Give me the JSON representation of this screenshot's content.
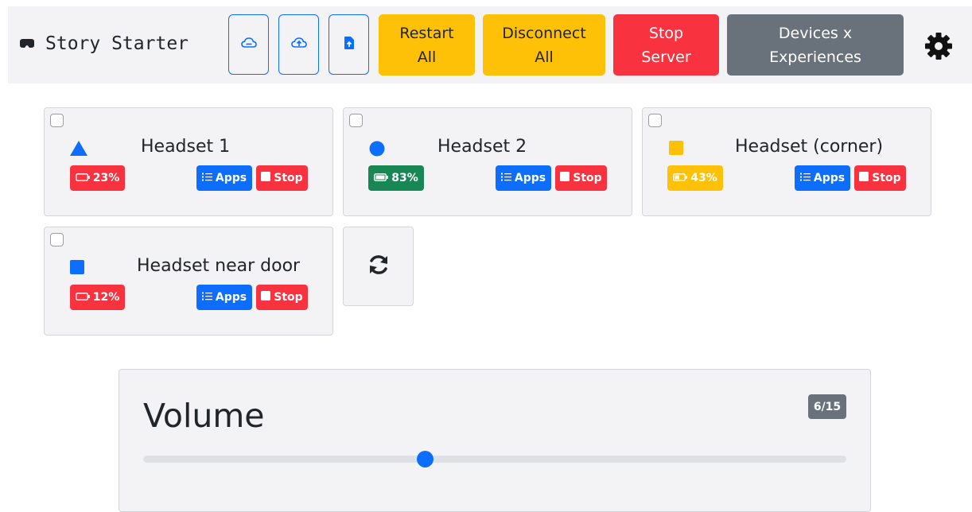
{
  "navbar": {
    "brand_title": "Story Starter",
    "brand_icon": "vr-headset-icon",
    "icon_buttons": [
      {
        "icon": "cloud-icon"
      },
      {
        "icon": "cloud-upload-icon"
      },
      {
        "icon": "file-upload-icon"
      }
    ],
    "restart_all": {
      "line1": "Restart",
      "line2": "All"
    },
    "disconnect_all": {
      "line1": "Disconnect",
      "line2": "All"
    },
    "stop_server": {
      "line1": "Stop",
      "line2": "Server"
    },
    "devices_experiences": {
      "line1": "Devices x",
      "line2": "Experiences"
    },
    "settings_icon": "gear-icon"
  },
  "headsets": [
    {
      "name": "Headset 1",
      "shape": "triangle",
      "shape_color": "#0d6efd",
      "battery": "23%",
      "battery_level": 0.23,
      "battery_color": "#f8323f",
      "apps_label": "Apps",
      "stop_label": "Stop"
    },
    {
      "name": "Headset 2",
      "shape": "circle",
      "shape_color": "#0d6efd",
      "battery": "83%",
      "battery_level": 0.83,
      "battery_color": "#198754",
      "apps_label": "Apps",
      "stop_label": "Stop"
    },
    {
      "name": "Headset (corner)",
      "shape": "square",
      "shape_color": "#ffc107",
      "battery": "43%",
      "battery_level": 0.43,
      "battery_color": "#ffc107",
      "apps_label": "Apps",
      "stop_label": "Stop"
    },
    {
      "name": "Headset near door",
      "shape": "square",
      "shape_color": "#0d6efd",
      "battery": "12%",
      "battery_level": 0.12,
      "battery_color": "#f8323f",
      "apps_label": "Apps",
      "stop_label": "Stop"
    }
  ],
  "refresh_icon": "refresh-icon",
  "volume": {
    "title": "Volume",
    "badge": "6/15",
    "value": 6,
    "max": 15
  },
  "colors": {
    "primary": "#0d6efd",
    "danger": "#f8323f",
    "warning": "#ffc107",
    "success": "#198754",
    "secondary": "#69727b"
  }
}
